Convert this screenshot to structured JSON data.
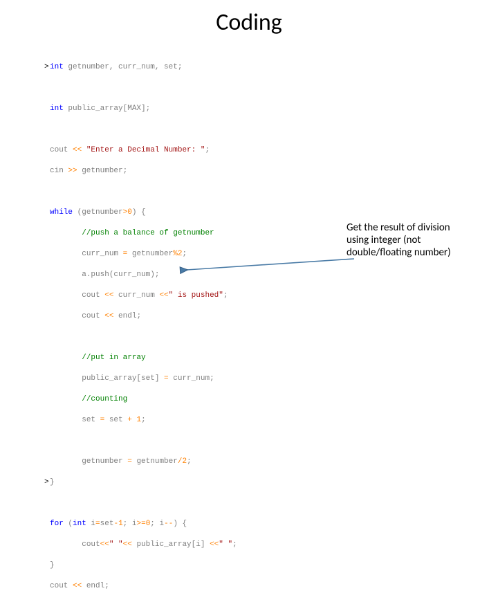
{
  "title": "Coding",
  "annotation": {
    "line1": "Get the result of division",
    "line2": "using integer (not",
    "line3": "double/floating number)"
  },
  "code": {
    "int_kw": "int",
    "decl_vars": " getnumber, curr_num, set;",
    "int_kw2": "int",
    "decl_arr": " public_array[MAX];",
    "cout1_a": "cout ",
    "cout1_op": "<<",
    "cout1_str": " \"Enter a Decimal Number: \"",
    "cout1_end": ";",
    "cin_a": "cin ",
    "cin_op": ">>",
    "cin_b": " getnumber;",
    "while_kw": "while",
    "while_a": " (getnumber",
    "while_op": ">",
    "while_num": "0",
    "while_b": ") {",
    "cmt_push": "//push a balance of getnumber",
    "cn_a": "curr_num ",
    "cn_op": "=",
    "cn_b": " getnumber",
    "cn_op2": "%",
    "cn_num": "2",
    "cn_end": ";",
    "apush": "a.push(curr_num);",
    "cout2_a": "cout ",
    "cout2_op": "<<",
    "cout2_b": " curr_num ",
    "cout2_op2": "<<",
    "cout2_str": "\" is pushed\"",
    "cout2_end": ";",
    "cout3_a": "cout ",
    "cout3_op": "<<",
    "cout3_b": " endl;",
    "cmt_put": "//put in array",
    "pa_a": "public_array[set] ",
    "pa_op": "=",
    "pa_b": " curr_num;",
    "cmt_count": "//counting",
    "set_a": "set ",
    "set_op": "=",
    "set_b": " set ",
    "set_op2": "+",
    "set_num": " 1",
    "set_end": ";",
    "gn_a": "getnumber ",
    "gn_op": "=",
    "gn_b": " getnumber",
    "gn_op2": "/",
    "gn_num": "2",
    "gn_end": ";",
    "close1": "}",
    "for_kw": "for",
    "for_a": " (",
    "for_int": "int",
    "for_b": " i",
    "for_op1": "=",
    "for_c": "set",
    "for_op2": "-",
    "for_n1": "1",
    "for_d": "; i",
    "for_op3": ">=",
    "for_n2": "0",
    "for_e": "; i",
    "for_op4": "--",
    "for_f": ") {",
    "fc_a": "cout",
    "fc_op1": "<<",
    "fc_str": "\" \"",
    "fc_op2": "<<",
    "fc_b": " public_array[i] ",
    "fc_op3": "<<",
    "fc_str2": "\" \"",
    "fc_end": ";",
    "close2": "}",
    "last_a": "cout ",
    "last_op": "<<",
    "last_b": " endl;"
  }
}
